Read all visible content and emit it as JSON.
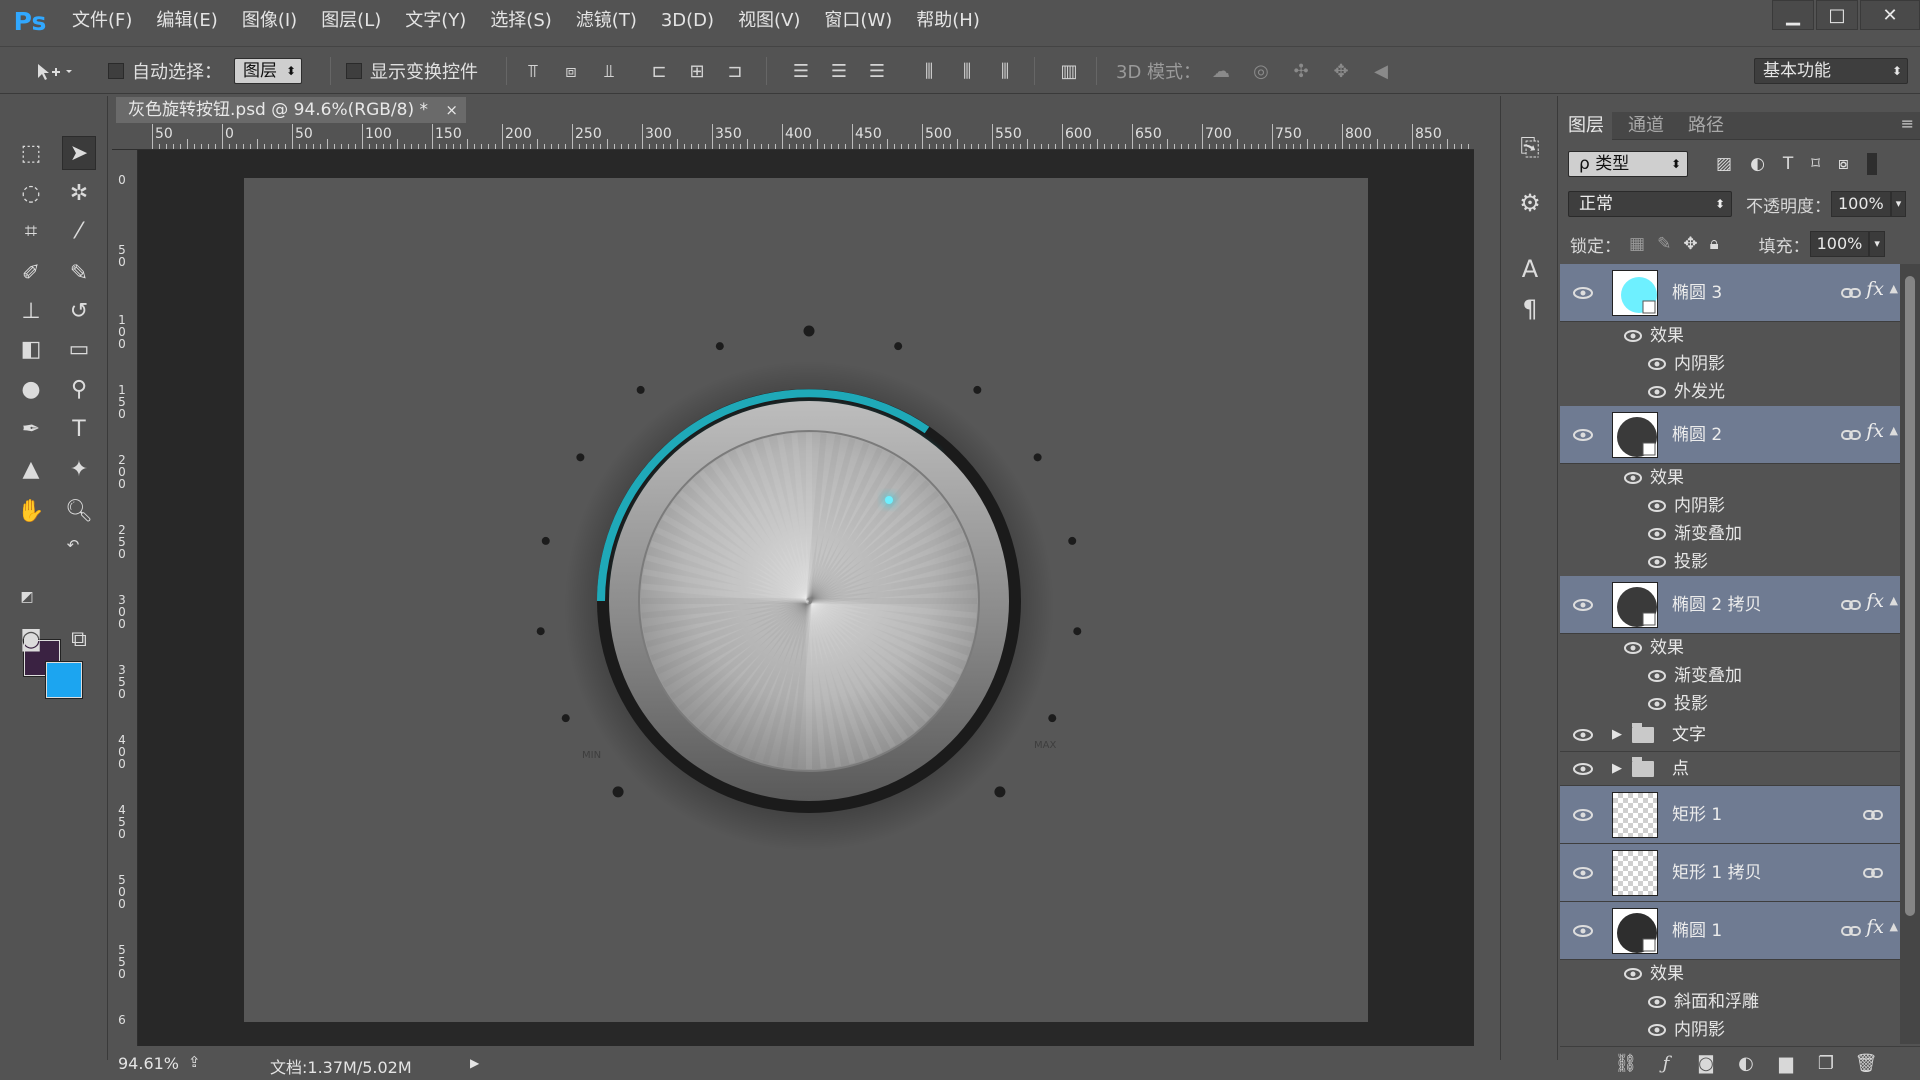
{
  "app": {
    "logo": "Ps"
  },
  "menu": [
    "文件(F)",
    "编辑(E)",
    "图像(I)",
    "图层(L)",
    "文字(Y)",
    "选择(S)",
    "滤镜(T)",
    "3D(D)",
    "视图(V)",
    "窗口(W)",
    "帮助(H)"
  ],
  "window_controls": {
    "minimize": "▁",
    "maximize": "□",
    "close": "✕"
  },
  "options": {
    "auto_select_label": "自动选择：",
    "auto_select_value": "图层",
    "show_transform_label": "显示变换控件",
    "mode3d_label": "3D 模式：",
    "workspace": "基本功能"
  },
  "document": {
    "tab_title": "灰色旋转按钮.psd @ 94.6%(RGB/8) *",
    "close": "×",
    "ruler_h": [
      "50",
      "0",
      "50",
      "100",
      "150",
      "200",
      "250",
      "300",
      "350",
      "400",
      "450",
      "500",
      "550",
      "600",
      "650",
      "700",
      "750",
      "800",
      "850"
    ],
    "ruler_v": [
      "0",
      "5 0",
      "1 0 0",
      "1 5 0",
      "2 0 0",
      "2 5 0",
      "3 0 0",
      "3 5 0",
      "4 0 0",
      "4 5 0",
      "5 0 0",
      "5 5 0",
      "6"
    ],
    "knob": {
      "min_label": "MIN",
      "max_label": "MAX",
      "accent": "#2ad4e6"
    }
  },
  "status": {
    "zoom": "94.61%",
    "doc_size": "文档:1.37M/5.02M"
  },
  "layers_panel": {
    "tabs": [
      "图层",
      "通道",
      "路径"
    ],
    "filter_kind": "ρ 类型",
    "blend_mode": "正常",
    "opacity_label": "不透明度：",
    "opacity_value": "100%",
    "lock_label": "锁定：",
    "fill_label": "填充：",
    "fill_value": "100%",
    "fx": "fx",
    "layers": [
      {
        "name": "椭圆 3",
        "effects_label": "效果",
        "effects": [
          "内阴影",
          "外发光"
        ]
      },
      {
        "name": "椭圆 2",
        "effects_label": "效果",
        "effects": [
          "内阴影",
          "渐变叠加",
          "投影"
        ]
      },
      {
        "name": "椭圆 2 拷贝",
        "effects_label": "效果",
        "effects": [
          "渐变叠加",
          "投影"
        ]
      },
      {
        "name": "文字"
      },
      {
        "name": "点"
      },
      {
        "name": "矩形 1"
      },
      {
        "name": "矩形 1 拷贝"
      },
      {
        "name": "椭圆 1",
        "effects_label": "效果",
        "effects": [
          "斜面和浮雕",
          "内阴影"
        ]
      }
    ]
  },
  "colors": {
    "foreground": "#3a2242",
    "background": "#1ca5f0",
    "selection": "#6f7b92"
  }
}
